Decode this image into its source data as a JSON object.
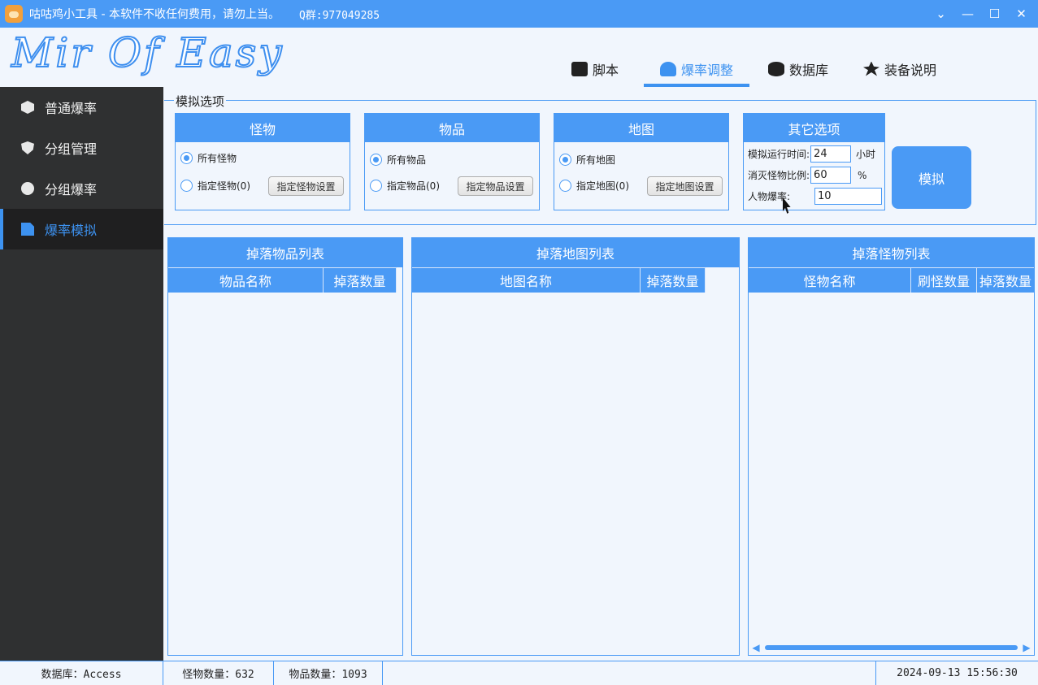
{
  "window": {
    "title": "咕咕鸡小工具 - 本软件不收任何费用，请勿上当。",
    "qq": "Q群:977049285",
    "controls": [
      "⌄",
      "—",
      "☐",
      "✕"
    ]
  },
  "header": {
    "logo": "Mir Of Easy",
    "tabs": [
      {
        "label": "脚本",
        "icon": "script-icon",
        "active": false
      },
      {
        "label": "爆率调整",
        "icon": "rate-icon",
        "active": true
      },
      {
        "label": "数据库",
        "icon": "database-icon",
        "active": false
      },
      {
        "label": "装备说明",
        "icon": "equipment-icon",
        "active": false
      }
    ]
  },
  "sidebar": {
    "items": [
      {
        "label": "普通爆率",
        "icon": "cube-icon",
        "active": false
      },
      {
        "label": "分组管理",
        "icon": "shield-icon",
        "active": false
      },
      {
        "label": "分组爆率",
        "icon": "dots-icon",
        "active": false
      },
      {
        "label": "爆率模拟",
        "icon": "document-icon",
        "active": true
      }
    ]
  },
  "options": {
    "legend": "模拟选项",
    "monster": {
      "title": "怪物",
      "all": "所有怪物",
      "specific": "指定怪物(0)",
      "button": "指定怪物设置",
      "selected": "all"
    },
    "item": {
      "title": "物品",
      "all": "所有物品",
      "specific": "指定物品(0)",
      "button": "指定物品设置",
      "selected": "all"
    },
    "map": {
      "title": "地图",
      "all": "所有地图",
      "specific": "指定地图(0)",
      "button": "指定地图设置",
      "selected": "all"
    },
    "other": {
      "title": "其它选项",
      "run_time_label": "模拟运行时间:",
      "run_time_value": "24",
      "run_time_unit": "小时",
      "kill_ratio_label": "消灭怪物比例:",
      "kill_ratio_value": "60",
      "kill_ratio_unit": "%",
      "char_rate_label": "人物爆率:",
      "char_rate_value": "10"
    },
    "simulate_button": "模拟"
  },
  "lists": {
    "items": {
      "title": "掉落物品列表",
      "col1": "物品名称",
      "col2": "掉落数量"
    },
    "maps": {
      "title": "掉落地图列表",
      "col1": "地图名称",
      "col2": "掉落数量"
    },
    "monsters": {
      "title": "掉落怪物列表",
      "col1": "怪物名称",
      "col2": "刷怪数量",
      "col3": "掉落数量"
    }
  },
  "status": {
    "database": "数据库：Access",
    "monster_count": "怪物数量：632",
    "item_count": "物品数量：1093",
    "datetime": "2024-09-13 15:56:30"
  },
  "colors": {
    "accent": "#4a9af5",
    "sidebar": "#2f3031",
    "background": "#f1f6fd"
  }
}
